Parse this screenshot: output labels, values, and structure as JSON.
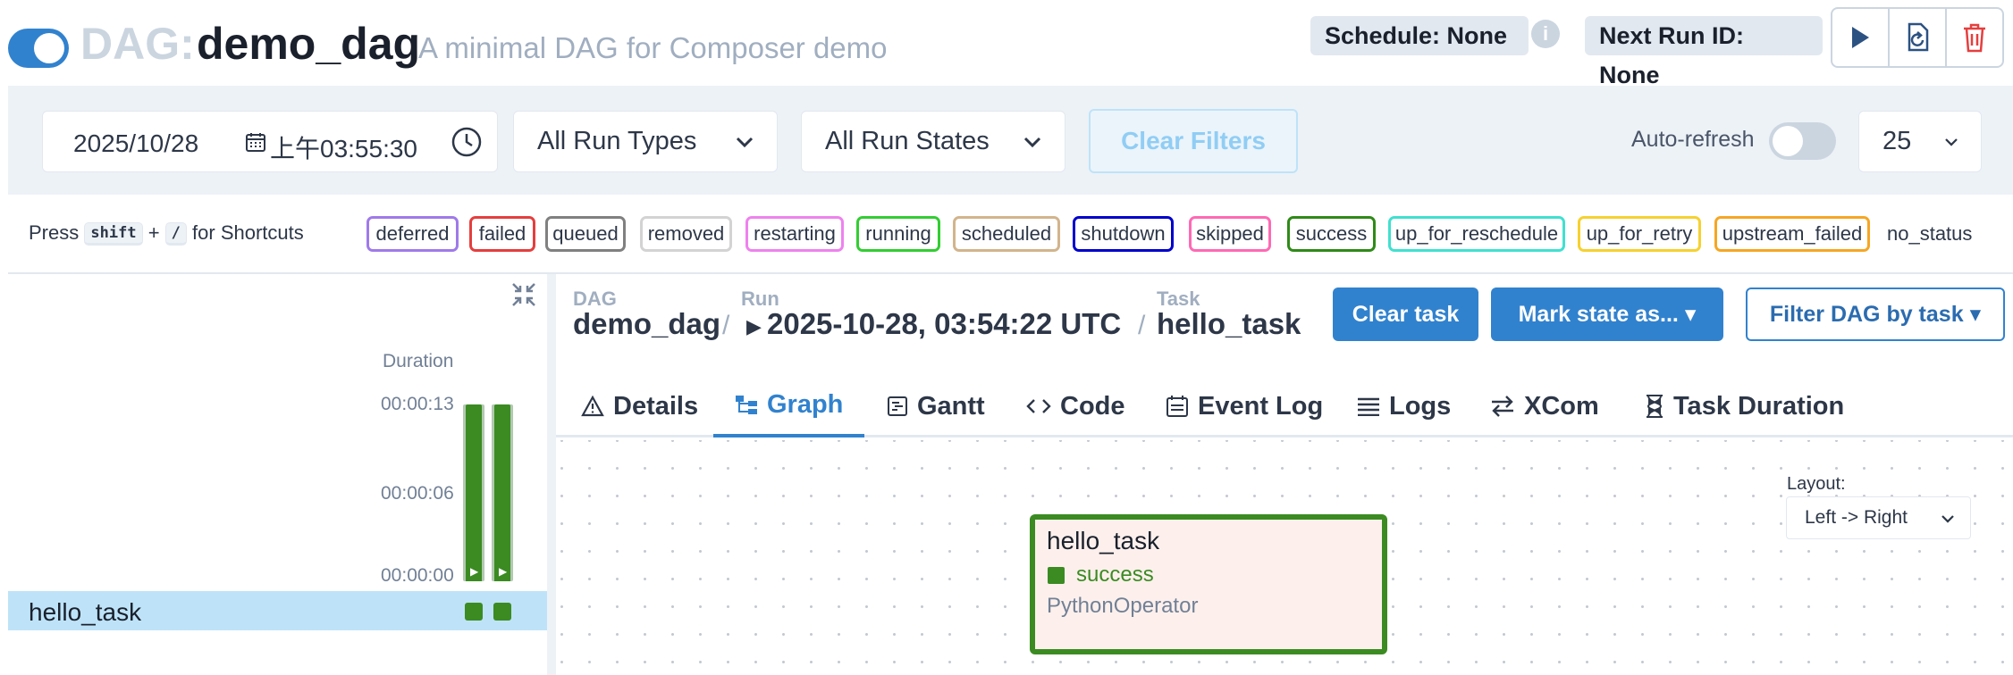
{
  "header": {
    "dag_prefix": "DAG:",
    "dag_id": "demo_dag",
    "description": "A minimal DAG for Composer demo",
    "schedule": "Schedule: None",
    "next_run": "Next Run ID: None",
    "info_icon_glyph": "i",
    "actions": [
      "play-icon",
      "reparse-icon",
      "trash-icon"
    ]
  },
  "filters": {
    "date": "2025/10/28",
    "time": "上午03:55:30",
    "run_types": "All Run Types",
    "run_states": "All Run States",
    "clear_filters": "Clear Filters",
    "auto_refresh_label": "Auto-refresh",
    "auto_refresh_on": false,
    "num_runs": "25"
  },
  "shortcuts": {
    "press": "Press",
    "key1": "shift",
    "plus": "+",
    "key2": "/",
    "suffix": "for Shortcuts"
  },
  "states": [
    {
      "label": "deferred",
      "color": "#9f7aea"
    },
    {
      "label": "failed",
      "color": "#e53e3e"
    },
    {
      "label": "queued",
      "color": "#808080"
    },
    {
      "label": "removed",
      "color": "#d3d3d3"
    },
    {
      "label": "restarting",
      "color": "#ee82ee"
    },
    {
      "label": "running",
      "color": "#32cd32"
    },
    {
      "label": "scheduled",
      "color": "#d2b48c"
    },
    {
      "label": "shutdown",
      "color": "#0000cd"
    },
    {
      "label": "skipped",
      "color": "#ff69b4"
    },
    {
      "label": "success",
      "color": "#2f8a18"
    },
    {
      "label": "up_for_reschedule",
      "color": "#40e0d0"
    },
    {
      "label": "up_for_retry",
      "color": "#f6d12f"
    },
    {
      "label": "upstream_failed",
      "color": "#f6a623"
    }
  ],
  "no_status": "no_status",
  "grid": {
    "duration_title": "Duration",
    "ticks": [
      "00:00:13",
      "00:00:06",
      "00:00:00"
    ],
    "run_durations_sec": [
      13,
      13
    ],
    "play_glyph": "▶",
    "task_name": "hello_task"
  },
  "details": {
    "crumbs": {
      "dag_label": "DAG",
      "dag_value": "demo_dag",
      "run_label": "Run",
      "run_value": "2025-10-28, 03:54:22 UTC",
      "task_label": "Task",
      "task_value": "hello_task",
      "sep": "/",
      "run_glyph": "▶"
    },
    "clear_task": "Clear task",
    "mark_state": "Mark state as...",
    "filter_dag": "Filter DAG by task",
    "caret": "▾",
    "tabs": [
      {
        "label": "Details",
        "icon": "warning-icon"
      },
      {
        "label": "Graph",
        "icon": "graph-icon"
      },
      {
        "label": "Gantt",
        "icon": "gantt-icon"
      },
      {
        "label": "Code",
        "icon": "code-icon"
      },
      {
        "label": "Event Log",
        "icon": "event-log-icon"
      },
      {
        "label": "Logs",
        "icon": "logs-icon"
      },
      {
        "label": "XCom",
        "icon": "xcom-icon"
      },
      {
        "label": "Task Duration",
        "icon": "hourglass-icon"
      }
    ],
    "active_tab": "Graph"
  },
  "graph": {
    "layout_label": "Layout:",
    "layout_value": "Left -> Right",
    "node": {
      "name": "hello_task",
      "state": "success",
      "operator": "PythonOperator"
    }
  },
  "colors": {
    "accent": "#3182ce",
    "success": "#3b8b22",
    "node_bg": "#fdf0ec"
  }
}
